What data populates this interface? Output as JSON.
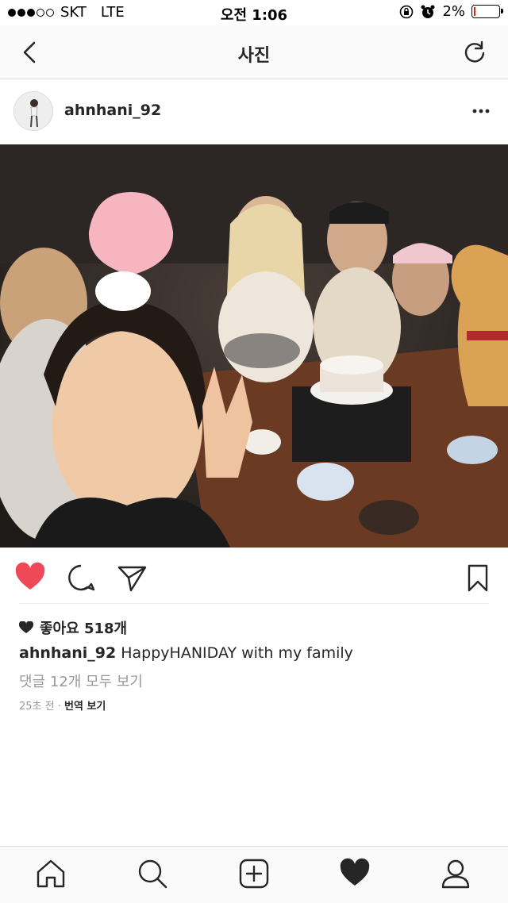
{
  "status_bar": {
    "carrier": "SKT",
    "network": "LTE",
    "time": "오전 1:06",
    "battery": "2%"
  },
  "nav": {
    "title": "사진",
    "back_icon": "chevron-left-icon",
    "refresh_icon": "refresh-icon"
  },
  "post": {
    "username": "ahnhani_92",
    "more_icon": "ellipsis-icon",
    "likes_text": "좋아요 518개",
    "caption_user": "ahnhani_92",
    "caption_text": "HappyHANIDAY with my family",
    "comments_link": "댓글 12개 모두 보기",
    "time_ago": "25초 전",
    "separator": "·",
    "translate": "번역 보기",
    "liked": true
  },
  "colors": {
    "like_red": "#ed4956",
    "text": "#262626",
    "muted": "#999999",
    "border": "#dbdbdb"
  },
  "tabs": [
    {
      "icon": "home-icon"
    },
    {
      "icon": "search-icon"
    },
    {
      "icon": "add-post-icon"
    },
    {
      "icon": "activity-heart-icon"
    },
    {
      "icon": "profile-icon"
    }
  ]
}
